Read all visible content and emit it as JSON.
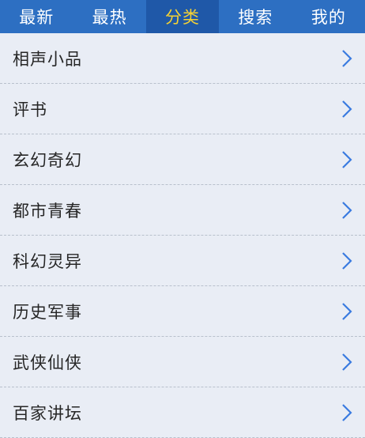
{
  "tabs": [
    {
      "label": "最新",
      "active": false
    },
    {
      "label": "最热",
      "active": false
    },
    {
      "label": "分类",
      "active": true
    },
    {
      "label": "搜索",
      "active": false
    },
    {
      "label": "我的",
      "active": false
    }
  ],
  "categories": [
    {
      "label": "相声小品"
    },
    {
      "label": "评书"
    },
    {
      "label": "玄幻奇幻"
    },
    {
      "label": "都市青春"
    },
    {
      "label": "科幻灵异"
    },
    {
      "label": "历史军事"
    },
    {
      "label": "武侠仙侠"
    },
    {
      "label": "百家讲坛"
    }
  ],
  "icons": {
    "row_arrow": "chevron-right-icon"
  },
  "colors": {
    "header_bg": "#2d6fc2",
    "active_tab_bg": "#1f58a8",
    "active_tab_text": "#f6d233",
    "list_bg": "#e9edf5",
    "chevron": "#3a7be0"
  }
}
